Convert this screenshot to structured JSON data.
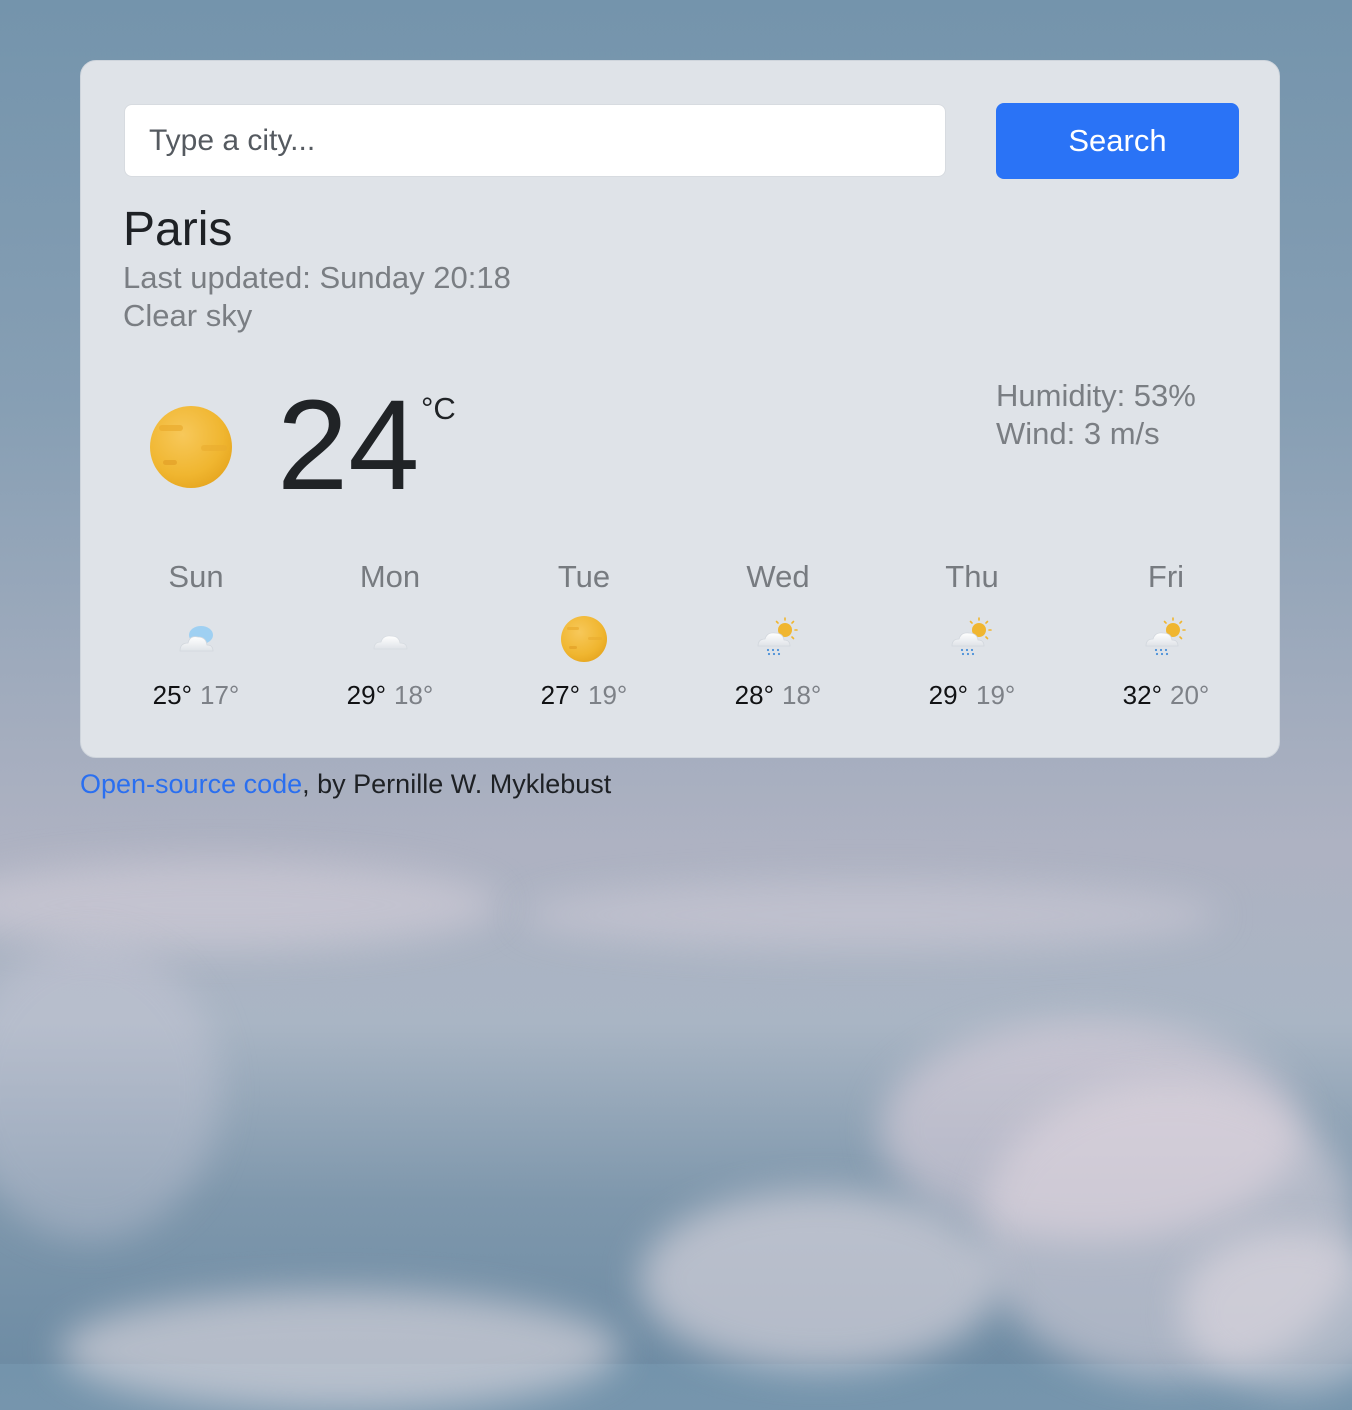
{
  "search": {
    "placeholder": "Type a city...",
    "button_label": "Search"
  },
  "current": {
    "city": "Paris",
    "last_updated": "Last updated: Sunday 20:18",
    "description": "Clear sky",
    "temperature": "24",
    "unit": "°C",
    "icon": "clear-sky-sun-icon",
    "humidity": "Humidity: 53%",
    "wind": "Wind: 3 m/s"
  },
  "forecast": [
    {
      "day": "Sun",
      "icon": "cloudy-icon",
      "max": "25°",
      "min": "17°"
    },
    {
      "day": "Mon",
      "icon": "cloud-icon",
      "max": "29°",
      "min": "18°"
    },
    {
      "day": "Tue",
      "icon": "sun-icon",
      "max": "27°",
      "min": "19°"
    },
    {
      "day": "Wed",
      "icon": "sun-cloud-rain-icon",
      "max": "28°",
      "min": "18°"
    },
    {
      "day": "Thu",
      "icon": "sun-cloud-rain-icon",
      "max": "29°",
      "min": "19°"
    },
    {
      "day": "Fri",
      "icon": "sun-cloud-rain-icon",
      "max": "32°",
      "min": "20°"
    }
  ],
  "footer": {
    "link_text": "Open-source code",
    "credit": ", by Pernille W. Myklebust"
  },
  "colors": {
    "accent": "#2a73f6",
    "link": "#2a6ff0",
    "card_bg": "#dfe3e8",
    "sun": "#f0b93a"
  }
}
